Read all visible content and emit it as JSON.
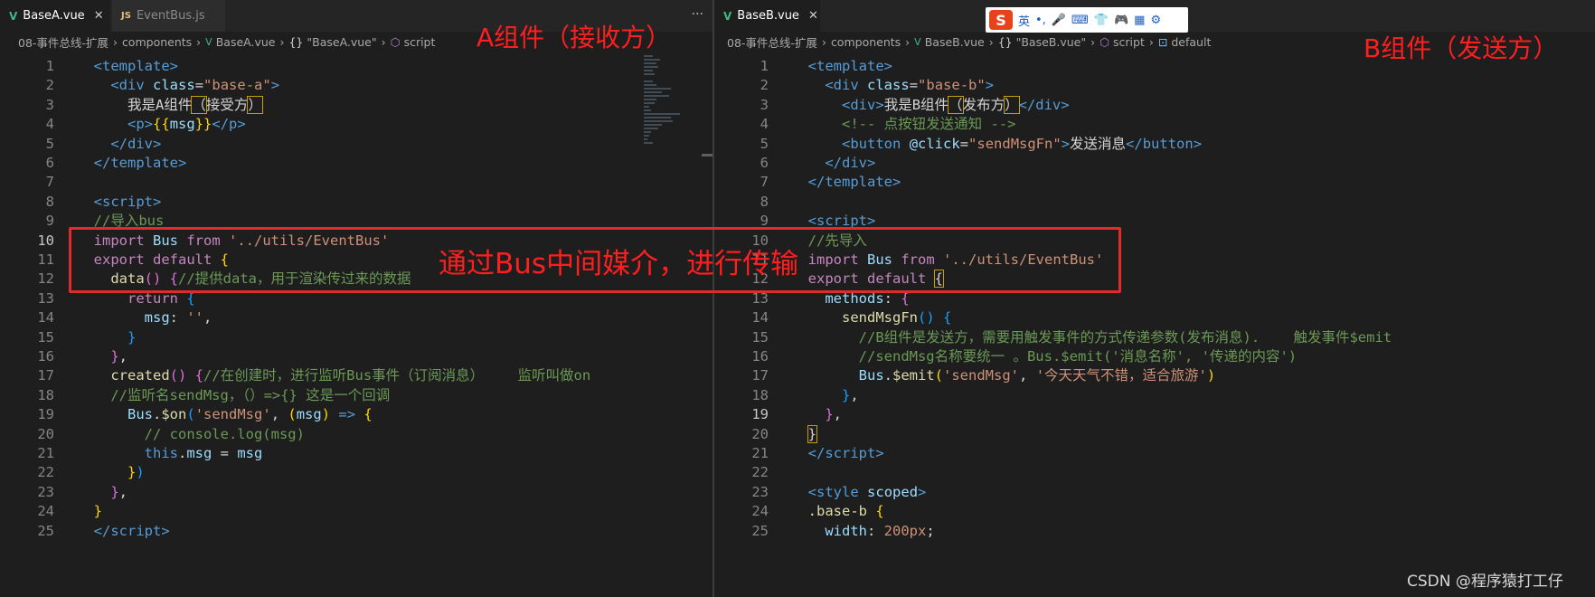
{
  "left_pane": {
    "tabs": [
      {
        "icon": "V",
        "label": "BaseA.vue",
        "close": "✕"
      },
      {
        "icon": "JS",
        "label": "EventBus.js"
      }
    ],
    "more": "···",
    "breadcrumb": [
      "08-事件总线-扩展",
      "components",
      "BaseA.vue",
      "\"BaseA.vue\"",
      "script"
    ],
    "lines": [
      {
        "n": "1",
        "t": [
          [
            "tg",
            "  <"
          ],
          [
            "tg",
            "template"
          ],
          [
            "tg",
            ">"
          ]
        ]
      },
      {
        "n": "2",
        "t": [
          [
            "tx",
            "    "
          ],
          [
            "tg",
            "<"
          ],
          [
            "tg",
            "div"
          ],
          [
            "tx",
            " "
          ],
          [
            "at",
            "class"
          ],
          [
            "tx",
            "="
          ],
          [
            "st",
            "\"base-a\""
          ],
          [
            "tg",
            ">"
          ]
        ]
      },
      {
        "n": "3",
        "t": [
          [
            "tx",
            "      我是A组件"
          ],
          [
            "hl",
            "（"
          ],
          [
            "tx",
            "接受方"
          ],
          [
            "hl",
            "）"
          ]
        ]
      },
      {
        "n": "4",
        "t": [
          [
            "tx",
            "      "
          ],
          [
            "tg",
            "<"
          ],
          [
            "tg",
            "p"
          ],
          [
            "tg",
            ">"
          ],
          [
            "br1",
            "{{"
          ],
          [
            "vr",
            "msg"
          ],
          [
            "br1",
            "}}"
          ],
          [
            "tg",
            "</"
          ],
          [
            "tg",
            "p"
          ],
          [
            "tg",
            ">"
          ]
        ]
      },
      {
        "n": "5",
        "t": [
          [
            "tx",
            "    "
          ],
          [
            "tg",
            "</"
          ],
          [
            "tg",
            "div"
          ],
          [
            "tg",
            ">"
          ]
        ]
      },
      {
        "n": "6",
        "t": [
          [
            "tx",
            "  "
          ],
          [
            "tg",
            "</"
          ],
          [
            "tg",
            "template"
          ],
          [
            "tg",
            ">"
          ]
        ]
      },
      {
        "n": "7",
        "t": []
      },
      {
        "n": "8",
        "t": [
          [
            "tx",
            "  "
          ],
          [
            "tg",
            "<"
          ],
          [
            "tg",
            "script"
          ],
          [
            "tg",
            ">"
          ]
        ]
      },
      {
        "n": "9",
        "t": [
          [
            "cm",
            "  //导入bus"
          ]
        ]
      },
      {
        "n": "10",
        "t": [
          [
            "kw",
            "  import"
          ],
          [
            "tx",
            " "
          ],
          [
            "vr",
            "Bus"
          ],
          [
            "tx",
            " "
          ],
          [
            "kw",
            "from"
          ],
          [
            "tx",
            " "
          ],
          [
            "st",
            "'../utils/EventBus'"
          ]
        ]
      },
      {
        "n": "11",
        "t": [
          [
            "kw",
            "  export"
          ],
          [
            "tx",
            " "
          ],
          [
            "kw",
            "default"
          ],
          [
            "tx",
            " "
          ],
          [
            "br1",
            "{"
          ]
        ]
      },
      {
        "n": "12",
        "t": [
          [
            "tx",
            "    "
          ],
          [
            "fn",
            "data"
          ],
          [
            "br2",
            "()"
          ],
          [
            "tx",
            " "
          ],
          [
            "br2",
            "{"
          ],
          [
            "cm",
            "//提供data，用于渲染传过来的数据"
          ]
        ]
      },
      {
        "n": "13",
        "t": [
          [
            "tx",
            "      "
          ],
          [
            "kw",
            "return"
          ],
          [
            "tx",
            " "
          ],
          [
            "br3",
            "{"
          ]
        ]
      },
      {
        "n": "14",
        "t": [
          [
            "tx",
            "        "
          ],
          [
            "vr",
            "msg"
          ],
          [
            "tx",
            ": "
          ],
          [
            "st",
            "''"
          ],
          [
            "tx",
            ","
          ]
        ]
      },
      {
        "n": "15",
        "t": [
          [
            "tx",
            "      "
          ],
          [
            "br3",
            "}"
          ]
        ]
      },
      {
        "n": "16",
        "t": [
          [
            "tx",
            "    "
          ],
          [
            "br2",
            "}"
          ],
          [
            "tx",
            ","
          ]
        ]
      },
      {
        "n": "17",
        "t": [
          [
            "tx",
            "    "
          ],
          [
            "fn",
            "created"
          ],
          [
            "br2",
            "()"
          ],
          [
            "tx",
            " "
          ],
          [
            "br2",
            "{"
          ],
          [
            "cm",
            "//在创建时，进行监听Bus事件（订阅消息）    监听叫做on"
          ]
        ]
      },
      {
        "n": "18",
        "t": [
          [
            "cm",
            "    //监听名sendMsg，（）=>{} 这是一个回调"
          ]
        ]
      },
      {
        "n": "19",
        "t": [
          [
            "tx",
            "      "
          ],
          [
            "vr",
            "Bus"
          ],
          [
            "tx",
            "."
          ],
          [
            "fn",
            "$on"
          ],
          [
            "br3",
            "("
          ],
          [
            "st",
            "'sendMsg'"
          ],
          [
            "tx",
            ", "
          ],
          [
            "br1",
            "("
          ],
          [
            "vr",
            "msg"
          ],
          [
            "br1",
            ")"
          ],
          [
            "tx",
            " "
          ],
          [
            "bl",
            "=>"
          ],
          [
            "tx",
            " "
          ],
          [
            "br1",
            "{"
          ]
        ]
      },
      {
        "n": "20",
        "t": [
          [
            "cm",
            "        // console.log(msg)"
          ]
        ]
      },
      {
        "n": "21",
        "t": [
          [
            "tx",
            "        "
          ],
          [
            "bl",
            "this"
          ],
          [
            "tx",
            "."
          ],
          [
            "vr",
            "msg"
          ],
          [
            "tx",
            " = "
          ],
          [
            "vr",
            "msg"
          ]
        ]
      },
      {
        "n": "22",
        "t": [
          [
            "tx",
            "      "
          ],
          [
            "br1",
            "}"
          ],
          [
            "br3",
            ")"
          ]
        ]
      },
      {
        "n": "23",
        "t": [
          [
            "tx",
            "    "
          ],
          [
            "br2",
            "}"
          ],
          [
            "tx",
            ","
          ]
        ]
      },
      {
        "n": "24",
        "t": [
          [
            "tx",
            "  "
          ],
          [
            "br1",
            "}"
          ]
        ]
      },
      {
        "n": "25",
        "t": [
          [
            "tx",
            "  "
          ],
          [
            "tg",
            "</"
          ],
          [
            "tg",
            "script"
          ],
          [
            "tg",
            ">"
          ]
        ]
      }
    ],
    "current_line": "10",
    "annotation": "A组件（接收方）"
  },
  "right_pane": {
    "tabs": [
      {
        "icon": "V",
        "label": "BaseB.vue",
        "close": "✕"
      }
    ],
    "breadcrumb": [
      "08-事件总线-扩展",
      "components",
      "BaseB.vue",
      "\"BaseB.vue\"",
      "script",
      "default"
    ],
    "lines": [
      {
        "n": "1",
        "t": [
          [
            "tg",
            "  <"
          ],
          [
            "tg",
            "template"
          ],
          [
            "tg",
            ">"
          ]
        ]
      },
      {
        "n": "2",
        "t": [
          [
            "tx",
            "    "
          ],
          [
            "tg",
            "<"
          ],
          [
            "tg",
            "div"
          ],
          [
            "tx",
            " "
          ],
          [
            "at",
            "class"
          ],
          [
            "tx",
            "="
          ],
          [
            "st",
            "\"base-b\""
          ],
          [
            "tg",
            ">"
          ]
        ]
      },
      {
        "n": "3",
        "t": [
          [
            "tx",
            "      "
          ],
          [
            "tg",
            "<"
          ],
          [
            "tg",
            "div"
          ],
          [
            "tg",
            ">"
          ],
          [
            "tx",
            "我是B组件"
          ],
          [
            "hl",
            "（"
          ],
          [
            "tx",
            "发布方"
          ],
          [
            "hl",
            "）"
          ],
          [
            "tg",
            "</"
          ],
          [
            "tg",
            "div"
          ],
          [
            "tg",
            ">"
          ]
        ]
      },
      {
        "n": "4",
        "t": [
          [
            "cm",
            "      <!-- 点按钮发送通知 -->"
          ]
        ]
      },
      {
        "n": "5",
        "t": [
          [
            "tx",
            "      "
          ],
          [
            "tg",
            "<"
          ],
          [
            "tg",
            "button"
          ],
          [
            "tx",
            " "
          ],
          [
            "at",
            "@click"
          ],
          [
            "tx",
            "="
          ],
          [
            "st",
            "\"sendMsgFn\""
          ],
          [
            "tg",
            ">"
          ],
          [
            "tx",
            "发送消息"
          ],
          [
            "tg",
            "</"
          ],
          [
            "tg",
            "button"
          ],
          [
            "tg",
            ">"
          ]
        ]
      },
      {
        "n": "6",
        "t": [
          [
            "tx",
            "    "
          ],
          [
            "tg",
            "</"
          ],
          [
            "tg",
            "div"
          ],
          [
            "tg",
            ">"
          ]
        ]
      },
      {
        "n": "7",
        "t": [
          [
            "tx",
            "  "
          ],
          [
            "tg",
            "</"
          ],
          [
            "tg",
            "template"
          ],
          [
            "tg",
            ">"
          ]
        ]
      },
      {
        "n": "8",
        "t": []
      },
      {
        "n": "9",
        "t": [
          [
            "tx",
            "  "
          ],
          [
            "tg",
            "<"
          ],
          [
            "tg",
            "script"
          ],
          [
            "tg",
            ">"
          ]
        ]
      },
      {
        "n": "10",
        "t": [
          [
            "cm",
            "  //先导入"
          ]
        ]
      },
      {
        "n": "11",
        "t": [
          [
            "kw",
            "  import"
          ],
          [
            "tx",
            " "
          ],
          [
            "vr",
            "Bus"
          ],
          [
            "tx",
            " "
          ],
          [
            "kw",
            "from"
          ],
          [
            "tx",
            " "
          ],
          [
            "st",
            "'../utils/EventBus'"
          ]
        ]
      },
      {
        "n": "12",
        "t": [
          [
            "kw",
            "  export"
          ],
          [
            "tx",
            " "
          ],
          [
            "kw",
            "default"
          ],
          [
            "tx",
            " "
          ],
          [
            "hl",
            "{"
          ]
        ]
      },
      {
        "n": "13",
        "t": [
          [
            "tx",
            "    "
          ],
          [
            "vr",
            "methods"
          ],
          [
            "tx",
            ": "
          ],
          [
            "br2",
            "{"
          ]
        ]
      },
      {
        "n": "14",
        "t": [
          [
            "tx",
            "      "
          ],
          [
            "fn",
            "sendMsgFn"
          ],
          [
            "br3",
            "()"
          ],
          [
            "tx",
            " "
          ],
          [
            "br3",
            "{"
          ]
        ]
      },
      {
        "n": "15",
        "t": [
          [
            "cm",
            "        //B组件是发送方，需要用触发事件的方式传递参数(发布消息).    触发事件$emit"
          ]
        ]
      },
      {
        "n": "16",
        "t": [
          [
            "cm",
            "        //sendMsg名称要统一 。Bus.$emit('消息名称', '传递的内容')"
          ]
        ]
      },
      {
        "n": "17",
        "t": [
          [
            "tx",
            "        "
          ],
          [
            "vr",
            "Bus"
          ],
          [
            "tx",
            "."
          ],
          [
            "fn",
            "$emit"
          ],
          [
            "br1",
            "("
          ],
          [
            "st",
            "'sendMsg'"
          ],
          [
            "tx",
            ", "
          ],
          [
            "st",
            "'今天天气不错，适合旅游'"
          ],
          [
            "br1",
            ")"
          ]
        ]
      },
      {
        "n": "18",
        "t": [
          [
            "tx",
            "      "
          ],
          [
            "br3",
            "}"
          ],
          [
            "tx",
            ","
          ]
        ]
      },
      {
        "n": "19",
        "t": [
          [
            "tx",
            "    "
          ],
          [
            "br2",
            "}"
          ],
          [
            "tx",
            ","
          ]
        ]
      },
      {
        "n": "20",
        "t": [
          [
            "tx",
            "  "
          ],
          [
            "hl",
            "}"
          ]
        ]
      },
      {
        "n": "21",
        "t": [
          [
            "tx",
            "  "
          ],
          [
            "tg",
            "</"
          ],
          [
            "tg",
            "script"
          ],
          [
            "tg",
            ">"
          ]
        ]
      },
      {
        "n": "22",
        "t": []
      },
      {
        "n": "23",
        "t": [
          [
            "tx",
            "  "
          ],
          [
            "tg",
            "<"
          ],
          [
            "tg",
            "style"
          ],
          [
            "tx",
            " "
          ],
          [
            "at",
            "scoped"
          ],
          [
            "tg",
            ">"
          ]
        ]
      },
      {
        "n": "24",
        "t": [
          [
            "fn",
            "  .base-b"
          ],
          [
            "tx",
            " "
          ],
          [
            "br1",
            "{"
          ]
        ]
      },
      {
        "n": "25",
        "t": [
          [
            "tx",
            "    "
          ],
          [
            "vr",
            "width"
          ],
          [
            "tx",
            ": "
          ],
          [
            "st",
            "200px"
          ],
          [
            "tx",
            ";"
          ]
        ]
      }
    ],
    "current_line": "19",
    "annotation": "B组件（发送方）"
  },
  "center_annotation": "通过Bus中间媒介，进行传输",
  "ime_toolbar": {
    "logo": "S",
    "items": [
      "英",
      "•,",
      "🎤",
      "⌨",
      "👕",
      "🎮",
      "▦",
      "⚙"
    ]
  },
  "watermark": "CSDN @程序猿打工仔"
}
